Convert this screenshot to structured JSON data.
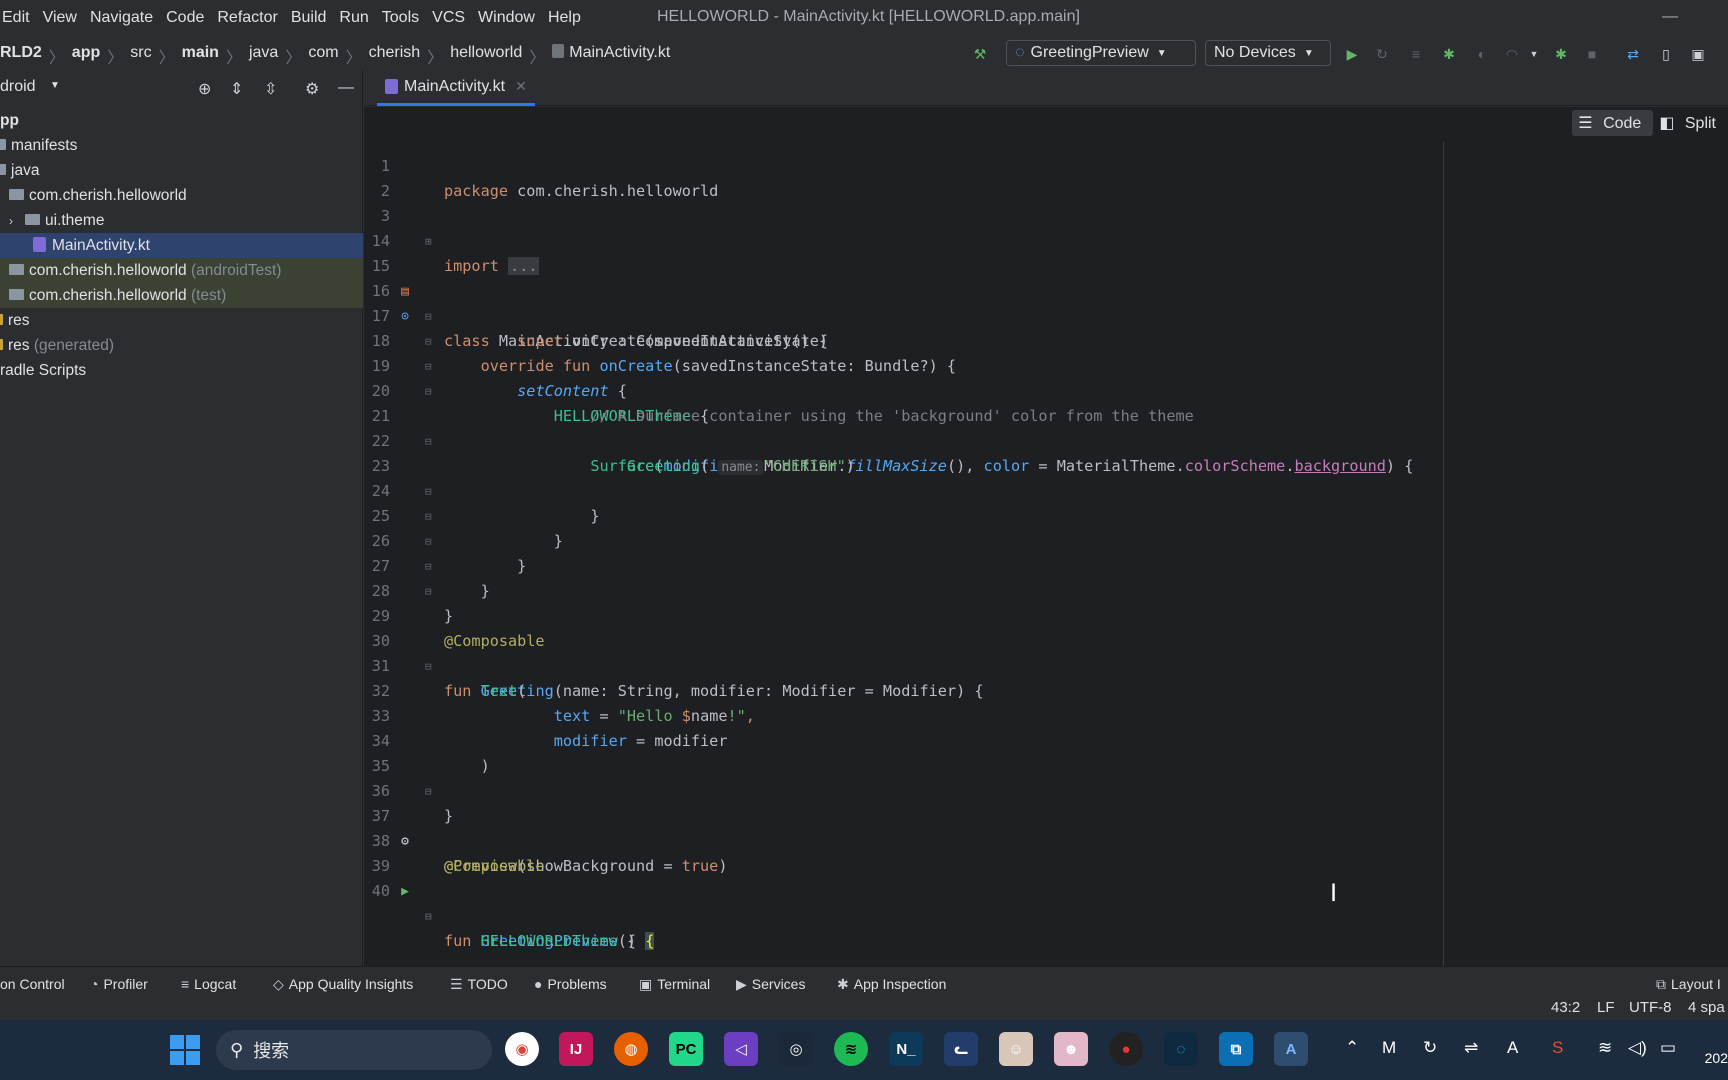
{
  "menubar": {
    "items": [
      "Edit",
      "View",
      "Navigate",
      "Code",
      "Refactor",
      "Build",
      "Run",
      "Tools",
      "VCS",
      "Window",
      "Help"
    ],
    "window_title": "HELLOWORLD - MainActivity.kt [HELLOWORLD.app.main]",
    "minimize_glyph": "—"
  },
  "breadcrumb": [
    "RLD2",
    "app",
    "src",
    "main",
    "java",
    "com",
    "cherish",
    "helloworld",
    "MainActivity.kt"
  ],
  "toolbar": {
    "run_config": "GreetingPreview",
    "device": "No Devices"
  },
  "project_panel": {
    "title": "droid",
    "items": [
      {
        "label": "pp",
        "suffix": ""
      },
      {
        "label": "manifests",
        "suffix": ""
      },
      {
        "label": "java",
        "suffix": ""
      },
      {
        "label": "com.cherish.helloworld",
        "suffix": ""
      },
      {
        "label": "ui.theme",
        "suffix": ""
      },
      {
        "label": "MainActivity.kt",
        "suffix": ""
      },
      {
        "label": "com.cherish.helloworld",
        "suffix": "(androidTest)"
      },
      {
        "label": "com.cherish.helloworld",
        "suffix": "(test)"
      },
      {
        "label": "res",
        "suffix": ""
      },
      {
        "label": "res",
        "suffix": "(generated)"
      },
      {
        "label": "radle Scripts",
        "suffix": ""
      }
    ]
  },
  "editor": {
    "tab_label": "MainActivity.kt",
    "view_modes": [
      "Code",
      "Split"
    ],
    "line_numbers": [
      "1",
      "2",
      "3",
      "14",
      "15",
      "16",
      "17",
      "18",
      "19",
      "20",
      "21",
      "22",
      "23",
      "24",
      "25",
      "26",
      "27",
      "28",
      "29",
      "30",
      "31",
      "32",
      "33",
      "34",
      "35",
      "36",
      "37",
      "38",
      "39",
      "40"
    ],
    "code": {
      "l1_kw": "package",
      "l1_rest": " com.cherish.helloworld",
      "l3_kw": "import",
      "l3_fold": "...",
      "l15_kw": "class",
      "l15_rest": " MainActivity : ComponentActivity() {",
      "l16_kw": "override fun",
      "l16_fn": "onCreate",
      "l16_rest": "(savedInstanceState: Bundle?) {",
      "l17_kw": "super",
      "l17_rest": ".onCreate(savedInstanceState)",
      "l18_fn": "setContent",
      "l18_rest": " {",
      "l19_theme": "HELLOWORLDTheme",
      "l19_rest": " {",
      "l20_comment": "// A surface container using the 'background' color from the theme",
      "l21_fn": "Surface",
      "l21_p1": "modifier",
      "l21_a": " = Modifier.",
      "l21_fi": "fillMaxSize",
      "l21_b": "(), ",
      "l21_p2": "color",
      "l21_c": " = MaterialTheme.",
      "l21_scheme": "colorScheme",
      "l21_dot": ".",
      "l21_bg": "background",
      "l21_end": ") {",
      "l22_fn": "Greeting",
      "l22_hint": "name:",
      "l22_str": "\"CHERISH\"",
      "l22_end": ")",
      "close_brace": "}",
      "l29_ann": "@Composable",
      "l30_kw": "fun",
      "l30_fn": "Greeting",
      "l30_rest": "(name: String, modifier: Modifier = Modifier) {",
      "l31_fn": "Text",
      "l31_rest": "(",
      "l32_p": "text",
      "l32_eq": " = ",
      "l32_str_a": "\"Hello ",
      "l32_dollar": "$",
      "l32_var": "name",
      "l32_str_b": "!\"",
      "l32_comma": ",",
      "l33_p": "modifier",
      "l33_rest": " = modifier",
      "l34_rest": ")",
      "l37_ann": "@Preview",
      "l37_a": "(showBackground = ",
      "l37_kw": "true",
      "l37_b": ")",
      "l38_ann": "@Composable",
      "l39_kw": "fun",
      "l39_fn": "GreetingPreview",
      "l39_rest": "() ",
      "l39_brace": "{",
      "l40_theme": "HELLOWORLDTheme",
      "l40_rest": " {"
    }
  },
  "tool_tabs": [
    "on Control",
    "Profiler",
    "Logcat",
    "App Quality Insights",
    "TODO",
    "Problems",
    "Terminal",
    "Services",
    "App Inspection",
    "Layout I"
  ],
  "status": {
    "position": "43:2",
    "line_sep": "LF",
    "encoding": "UTF-8",
    "indent": "4 spa"
  },
  "taskbar": {
    "search_placeholder": "搜索",
    "clock": "202"
  },
  "colors": {
    "editor_bg": "#1e1f22",
    "panel_bg": "#2b2d30",
    "keyword": "#cf8e6d",
    "function": "#56a8f5",
    "string": "#6aab73",
    "annotation": "#b3ae60",
    "accent": "#3574f0"
  }
}
